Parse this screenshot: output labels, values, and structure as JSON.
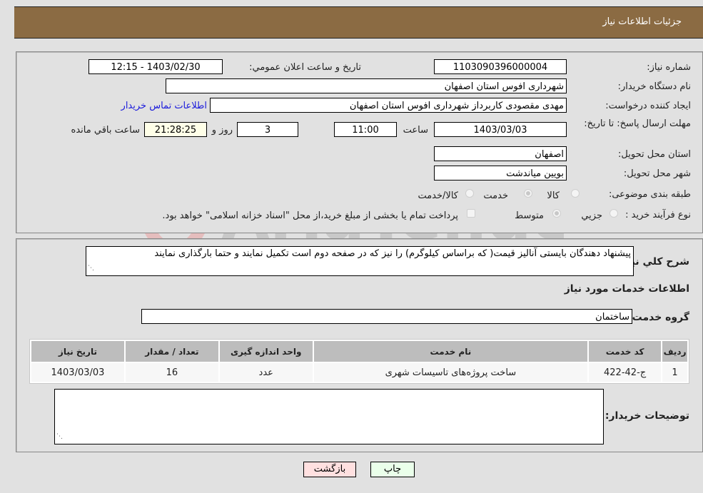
{
  "header": {
    "title": "جزئیات اطلاعات نیاز"
  },
  "details": {
    "need_number_label": "شماره نیاز:",
    "need_number": "1103090396000004",
    "announce_label": "تاریخ و ساعت اعلان عمومي:",
    "announce_value": "1403/02/30 - 12:15",
    "buyer_org_label": "نام دستگاه خریدار:",
    "buyer_org": "شهرداری افوس استان اصفهان",
    "creator_label": "ایجاد کننده درخواست:",
    "creator": "مهدی مقصودی کاربرداز شهرداری افوس استان اصفهان",
    "contact_link": "اطلاعات تماس خریدار",
    "deadline_label": "مهلت ارسال پاسخ: تا تاریخ:",
    "deadline_date": "1403/03/03",
    "time_label": "ساعت",
    "deadline_time": "11:00",
    "days_value": "3",
    "days_label": "روز و",
    "remaining_time": "21:28:25",
    "remaining_label": "ساعت باقي مانده",
    "province_label": "استان محل تحویل:",
    "province": "اصفهان",
    "city_label": "شهر محل تحویل:",
    "city": "بویین میاندشت",
    "category_label": "طبقه بندی موضوعی:",
    "category_options": [
      {
        "label": "کالا",
        "selected": false
      },
      {
        "label": "خدمت",
        "selected": true
      },
      {
        "label": "کالا/خدمت",
        "selected": false
      }
    ],
    "process_label": "نوع فرآیند خرید :",
    "process_options": [
      {
        "label": "جزيي",
        "selected": false
      },
      {
        "label": "متوسط",
        "selected": true
      }
    ],
    "treasury_checkbox_label": "پرداخت تمام یا بخشی از مبلغ خرید،از محل \"اسناد خزانه اسلامی\" خواهد بود.",
    "treasury_checked": false
  },
  "services": {
    "description_label": "شرح کلي نیاز:",
    "description": "پیشنهاد دهندگان بایستی آنالیز قیمت( که براساس کیلوگرم) را نیز که در صفحه دوم است تکمیل نمایند و حتما بارگذاری نمایند",
    "section_title": "اطلاعات خدمات مورد نیاز",
    "group_label": "گروه خدمت:",
    "group_value": "ساختمان",
    "table": {
      "headers": [
        "ردیف",
        "کد خدمت",
        "نام خدمت",
        "واحد اندازه گیری",
        "تعداد / مقدار",
        "تاریخ نیاز"
      ],
      "rows": [
        [
          "1",
          "ج-42-422",
          "ساخت پروژه‌های تاسیسات شهری",
          "عدد",
          "16",
          "1403/03/03"
        ]
      ]
    },
    "buyer_notes_label": "توضیحات خریدار:",
    "buyer_notes": ""
  },
  "buttons": {
    "print": "چاپ",
    "back": "بازگشت"
  },
  "watermark": {
    "text": "AriaTender.neT"
  },
  "colors": {
    "header_bg": "#8b6b43",
    "print_bg": "#eaffea",
    "back_bg": "#ffe0e0"
  }
}
